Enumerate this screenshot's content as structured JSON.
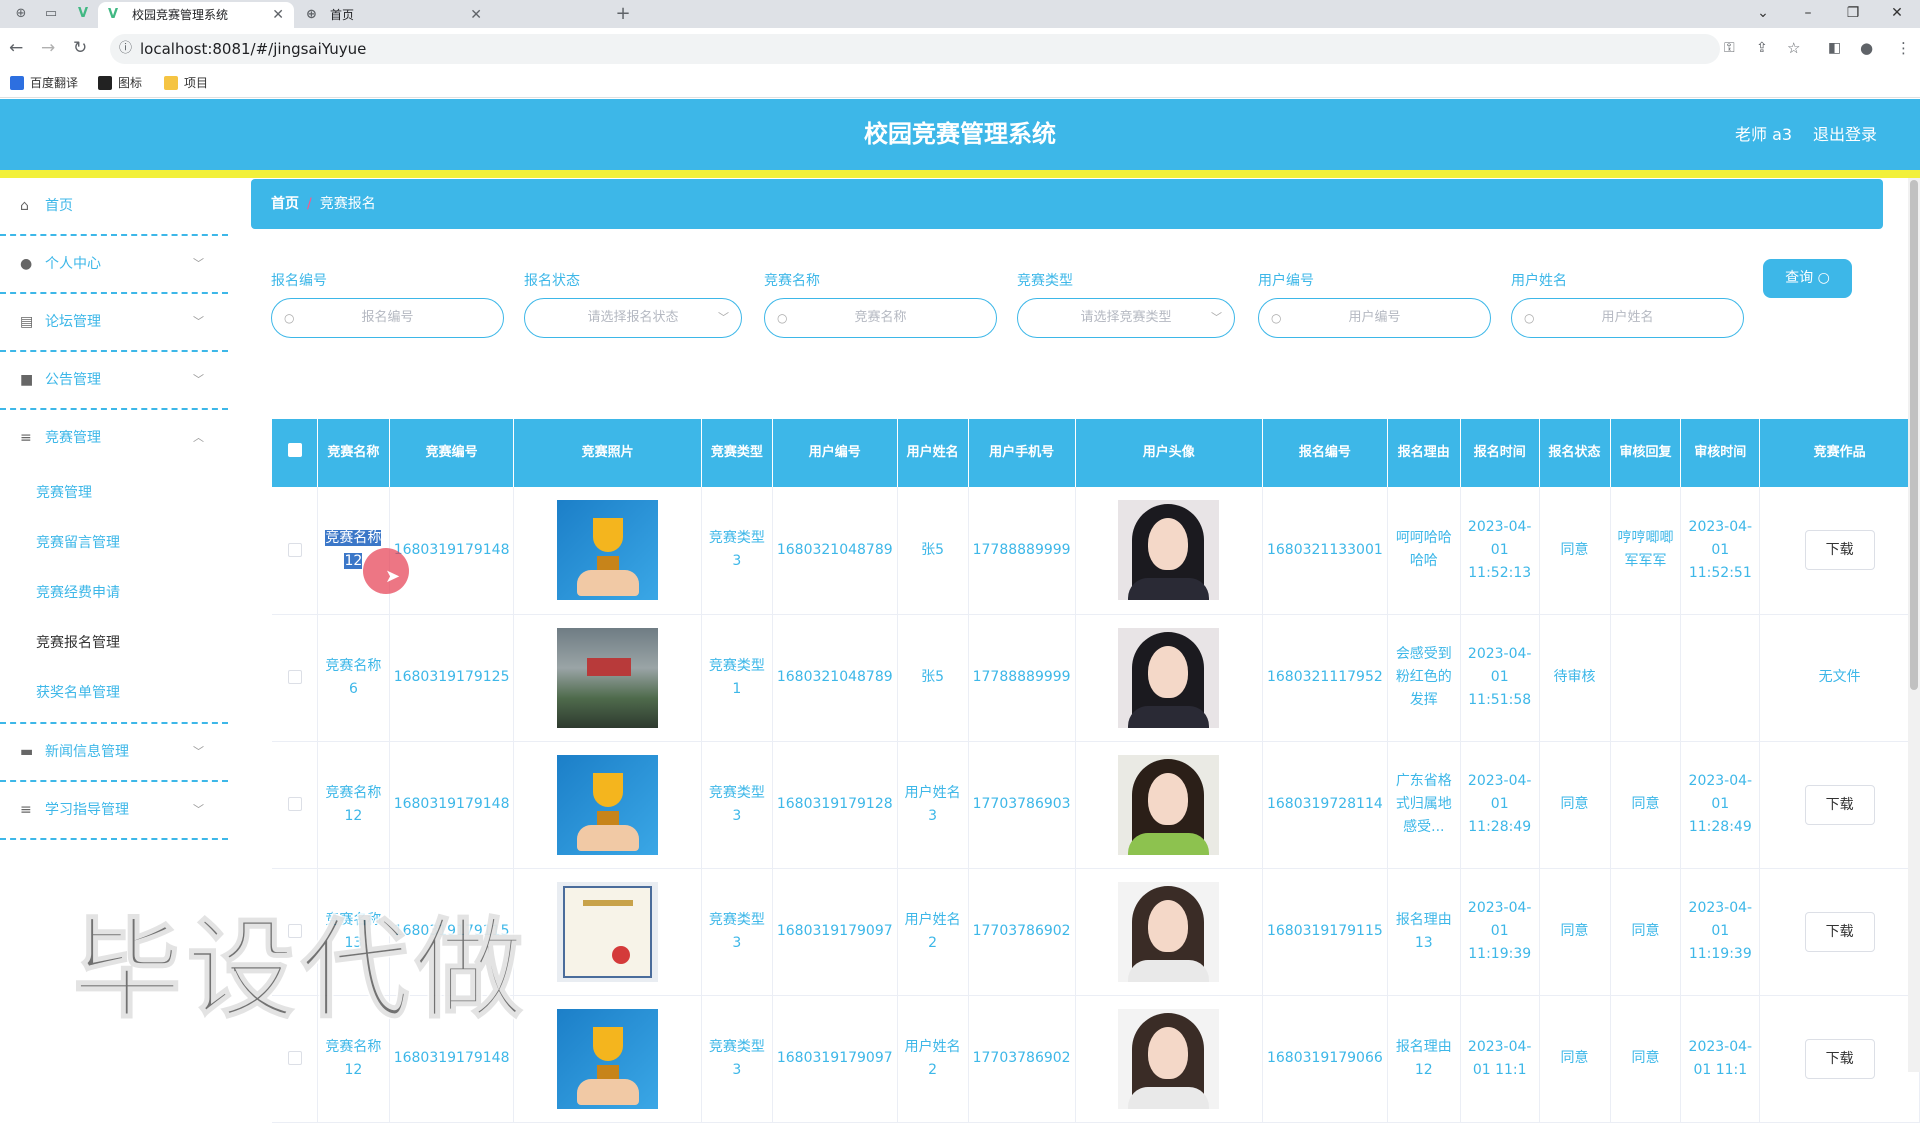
{
  "browser": {
    "tabs": [
      {
        "title": "校园竞赛管理系统",
        "active": true
      },
      {
        "title": "首页",
        "active": false
      }
    ],
    "url": "localhost:8081/#/jingsaiYuyue",
    "bookmarks": [
      "百度翻译",
      "图标",
      "项目"
    ]
  },
  "header": {
    "title": "校园竞赛管理系统",
    "user": "老师 a3",
    "logout": "退出登录"
  },
  "sidebar": {
    "items": [
      {
        "label": "首页",
        "icon": "home-icon"
      },
      {
        "label": "个人中心",
        "icon": "user-icon"
      },
      {
        "label": "论坛管理",
        "icon": "forum-icon"
      },
      {
        "label": "公告管理",
        "icon": "briefcase-icon"
      },
      {
        "label": "竞赛管理",
        "icon": "list-icon"
      }
    ],
    "submenu": [
      "竞赛管理",
      "竞赛留言管理",
      "竞赛经费申请",
      "竞赛报名管理",
      "获奖名单管理"
    ],
    "items_after": [
      {
        "label": "新闻信息管理",
        "icon": "chat-icon"
      },
      {
        "label": "学习指导管理",
        "icon": "list-icon"
      }
    ]
  },
  "breadcrumb": {
    "home": "首页",
    "current": "竞赛报名"
  },
  "filters": [
    {
      "label": "报名编号",
      "placeholder": "报名编号"
    },
    {
      "label": "报名状态",
      "placeholder": "请选择报名状态"
    },
    {
      "label": "竞赛名称",
      "placeholder": "竞赛名称"
    },
    {
      "label": "竞赛类型",
      "placeholder": "请选择竞赛类型"
    },
    {
      "label": "用户编号",
      "placeholder": "用户编号"
    },
    {
      "label": "用户姓名",
      "placeholder": "用户姓名"
    }
  ],
  "search_button": "查询",
  "table": {
    "headers": [
      "竞赛名称",
      "竞赛编号",
      "竞赛照片",
      "竞赛类型",
      "用户编号",
      "用户姓名",
      "用户手机号",
      "用户头像",
      "报名编号",
      "报名理由",
      "报名时间",
      "报名状态",
      "审核回复",
      "审核时间",
      "竞赛作品"
    ],
    "rows": [
      {
        "name": "竞赛名称12",
        "code": "1680319179148",
        "photo": "trophy",
        "type": "竞赛类型3",
        "uid": "1680321048789",
        "uname": "张5",
        "phone": "17788889999",
        "avatar": "dark",
        "regno": "1680321133001",
        "reason": "呵呵哈哈哈哈",
        "time": "2023-04-01 11:52:13",
        "status": "同意",
        "reply": "哼哼唧唧军军军",
        "rtime": "2023-04-01 11:52:51",
        "work": "下载"
      },
      {
        "name": "竞赛名称6",
        "code": "1680319179125",
        "photo": "photo",
        "type": "竞赛类型1",
        "uid": "1680321048789",
        "uname": "张5",
        "phone": "17788889999",
        "avatar": "dark",
        "regno": "1680321117952",
        "reason": "会感受到粉红色的发挥",
        "time": "2023-04-01 11:51:58",
        "status": "待审核",
        "reply": "",
        "rtime": "",
        "work": "无文件"
      },
      {
        "name": "竞赛名称12",
        "code": "1680319179148",
        "photo": "trophy",
        "type": "竞赛类型3",
        "uid": "1680319179128",
        "uname": "用户姓名3",
        "phone": "17703786903",
        "avatar": "green",
        "regno": "1680319728114",
        "reason": "广东省格式归属地感受...",
        "time": "2023-04-01 11:28:49",
        "status": "同意",
        "reply": "同意",
        "rtime": "2023-04-01 11:28:49",
        "work": "下载"
      },
      {
        "name": "竞赛名称13",
        "code": "1680319179115",
        "photo": "cert",
        "type": "竞赛类型3",
        "uid": "1680319179097",
        "uname": "用户姓名2",
        "phone": "17703786902",
        "avatar": "white",
        "regno": "1680319179115",
        "reason": "报名理由13",
        "time": "2023-04-01 11:19:39",
        "status": "同意",
        "reply": "同意",
        "rtime": "2023-04-01 11:19:39",
        "work": "下载"
      },
      {
        "name": "竞赛名称12",
        "code": "1680319179148",
        "photo": "trophy",
        "type": "竞赛类型3",
        "uid": "1680319179097",
        "uname": "用户姓名2",
        "phone": "17703786902",
        "avatar": "white",
        "regno": "1680319179066",
        "reason": "报名理由12",
        "time": "2023-04-01 11:1",
        "status": "同意",
        "reply": "同意",
        "rtime": "2023-04-01 11:1",
        "work": "下载"
      }
    ]
  },
  "watermark": "毕设代做",
  "colors": {
    "primary": "#3db7e8",
    "accent_line": "#f2f03a"
  }
}
